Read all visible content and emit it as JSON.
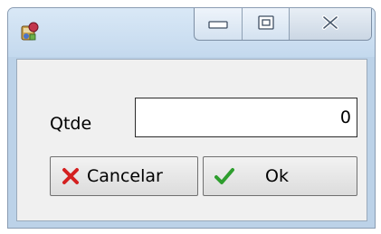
{
  "window": {
    "app_icon": "app-icon",
    "caption_buttons": [
      "minimize-icon",
      "maximize-icon",
      "close-icon"
    ]
  },
  "form": {
    "qtde_label": "Qtde",
    "qtde_value": "0"
  },
  "buttons": {
    "cancel_label": "Cancelar",
    "cancel_icon": "red-x-icon",
    "ok_label": "Ok",
    "ok_icon": "green-check-icon"
  },
  "colors": {
    "cancel_icon": "#d42020",
    "ok_icon": "#2e9e2e",
    "frame": "#bcd2e8"
  }
}
